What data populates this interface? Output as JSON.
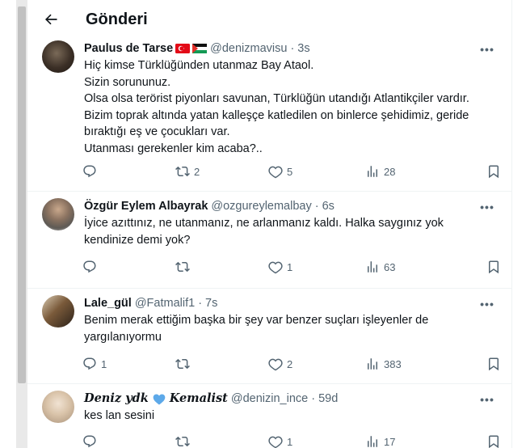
{
  "header": {
    "title": "Gönderi"
  },
  "tweets": [
    {
      "name": "Paulus de Tarse",
      "handle": "@denizmavisu",
      "time": "3s",
      "lines": [
        "Hiç kimse Türklüğünden utanmaz Bay Ataol.",
        "Sizin sorununuz.",
        "Olsa olsa terörist piyonları savunan, Türklüğün utandığı Atlantikçiler vardır.",
        "Bizim toprak altında yatan kalleşçe katledilen on binlerce şehidimiz, geride",
        "bıraktığı eş ve çocukları var.",
        "Utanması gerekenler kim acaba?.."
      ],
      "reply_count": "",
      "retweet_count": "2",
      "like_count": "5",
      "view_count": "28"
    },
    {
      "name": "Özgür Eylem Albayrak",
      "handle": "@ozgureylemalbay",
      "time": "6s",
      "lines": [
        "İyice azıttınız, ne utanmanız, ne arlanmanız kaldı. Halka saygınız yok",
        "kendinize demi yok?"
      ],
      "reply_count": "",
      "retweet_count": "",
      "like_count": "1",
      "view_count": "63"
    },
    {
      "name": "Lale_gül",
      "handle": "@Fatmalif1",
      "time": "7s",
      "lines": [
        "Benim merak ettiğim başka bir şey var benzer suçları işleyenler de",
        "yargılanıyormu"
      ],
      "reply_count": "1",
      "retweet_count": "",
      "like_count": "2",
      "view_count": "383"
    },
    {
      "name_part1": "Deniz ydk",
      "name_part2": "Kemalist",
      "handle": "@denizin_ince",
      "time": "59d",
      "lines": [
        "kes lan sesini"
      ],
      "reply_count": "",
      "retweet_count": "",
      "like_count": "1",
      "view_count": "17"
    }
  ],
  "icons": {
    "back": "arrow-left-icon",
    "more": "more-horizontal-icon",
    "reply": "reply-icon",
    "retweet": "retweet-icon",
    "like": "heart-icon",
    "views": "views-icon",
    "bookmark": "bookmark-icon",
    "share": "share-icon"
  },
  "colors": {
    "text": "#0f1419",
    "secondary": "#536471",
    "border": "#eff3f4",
    "heart_emoji": "#5da9e9"
  }
}
